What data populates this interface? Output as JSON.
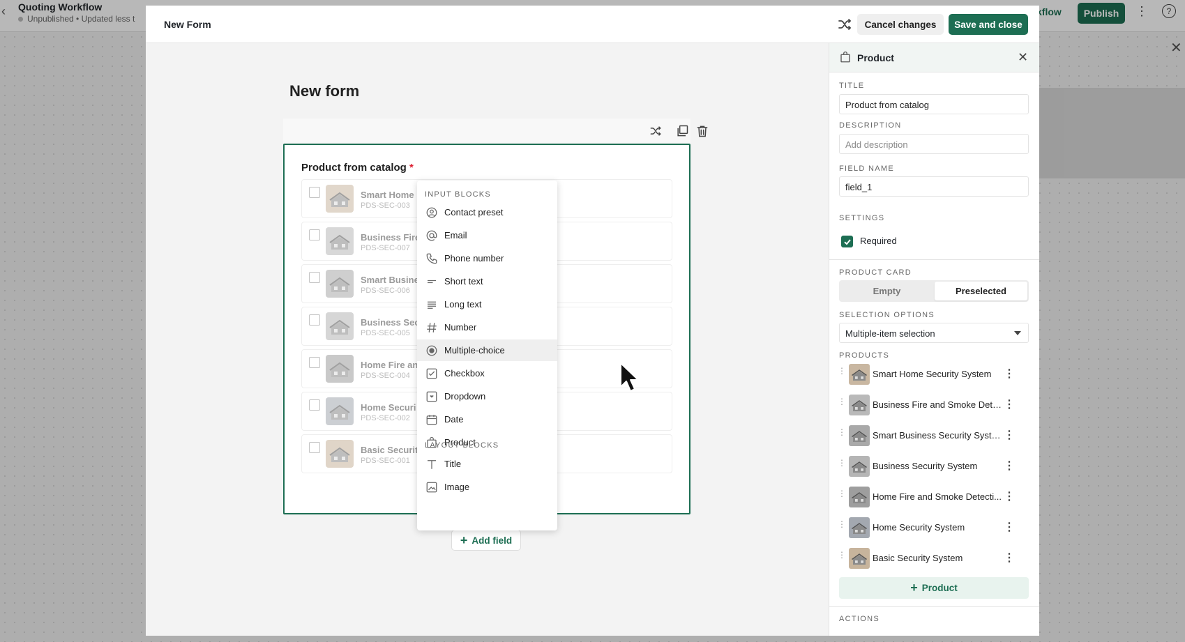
{
  "background": {
    "title": "Quoting Workflow",
    "status": "Unpublished",
    "updated": "Updated less t",
    "workflow_link": "kflow",
    "publish_label": "Publish"
  },
  "modal": {
    "title": "New Form",
    "cancel_label": "Cancel changes",
    "save_label": "Save and close"
  },
  "form": {
    "heading": "New form",
    "field_label": "Product from catalog",
    "required_mark": "*",
    "add_field_label": "Add field",
    "products": [
      {
        "name": "Smart Home",
        "sku": "PDS-SEC-003"
      },
      {
        "name": "Business Fire",
        "sku": "PDS-SEC-007"
      },
      {
        "name": "Smart Busine",
        "sku": "PDS-SEC-006"
      },
      {
        "name": "Business Sec",
        "sku": "PDS-SEC-005"
      },
      {
        "name": "Home Fire an",
        "sku": "PDS-SEC-004"
      },
      {
        "name": "Home Securi",
        "sku": "PDS-SEC-002"
      },
      {
        "name": "Basic Securit",
        "sku": "PDS-SEC-001"
      }
    ]
  },
  "menu": {
    "input_section": "INPUT BLOCKS",
    "layout_section": "LAYOUT BLOCKS",
    "input_items": [
      {
        "label": "Contact preset",
        "icon": "contact-icon"
      },
      {
        "label": "Email",
        "icon": "at-icon"
      },
      {
        "label": "Phone number",
        "icon": "phone-icon"
      },
      {
        "label": "Short text",
        "icon": "short-text-icon"
      },
      {
        "label": "Long text",
        "icon": "long-text-icon"
      },
      {
        "label": "Number",
        "icon": "hash-icon"
      },
      {
        "label": "Multiple-choice",
        "icon": "radio-icon"
      },
      {
        "label": "Checkbox",
        "icon": "checkbox-icon"
      },
      {
        "label": "Dropdown",
        "icon": "dropdown-icon"
      },
      {
        "label": "Date",
        "icon": "calendar-icon"
      },
      {
        "label": "Product",
        "icon": "bag-icon"
      }
    ],
    "layout_items": [
      {
        "label": "Title",
        "icon": "title-icon"
      },
      {
        "label": "Image",
        "icon": "image-icon"
      }
    ]
  },
  "panel": {
    "header": "Product",
    "title_label": "TITLE",
    "title_value": "Product from catalog",
    "description_label": "DESCRIPTION",
    "description_placeholder": "Add description",
    "field_name_label": "FIELD NAME",
    "field_name_value": "field_1",
    "settings_label": "SETTINGS",
    "required_label": "Required",
    "required_checked": true,
    "product_card_label": "PRODUCT CARD",
    "card_options": [
      "Empty",
      "Preselected"
    ],
    "card_selected": "Preselected",
    "selection_label": "SELECTION OPTIONS",
    "selection_value": "Multiple-item selection",
    "products_label": "PRODUCTS",
    "products": [
      "Smart Home Security System",
      "Business Fire and Smoke Dete...",
      "Smart Business Security System",
      "Business Security System",
      "Home Fire and Smoke Detecti...",
      "Home Security System",
      "Basic Security System"
    ],
    "add_product_label": "Product",
    "actions_label": "ACTIONS"
  },
  "colors": {
    "brand": "#1d6e53",
    "required": "#dd2233"
  }
}
